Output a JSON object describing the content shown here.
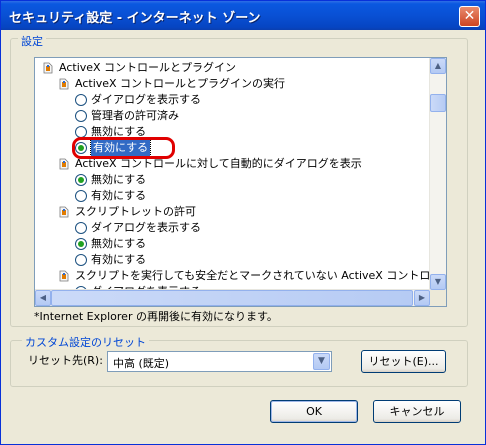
{
  "window": {
    "title": "セキュリティ設定 - インターネット ゾーン",
    "close_glyph": "✕"
  },
  "settings": {
    "group_label": "設定",
    "rows": [
      {
        "type": "category",
        "label": "ActiveX コントロールとプラグイン"
      },
      {
        "type": "category",
        "label": "ActiveX コントロールとプラグインの実行"
      },
      {
        "type": "radio",
        "label": "ダイアログを表示する",
        "checked": false
      },
      {
        "type": "radio",
        "label": "管理者の許可済み",
        "checked": false
      },
      {
        "type": "radio",
        "label": "無効にする",
        "checked": false
      },
      {
        "type": "radio",
        "label": "有効にする",
        "checked": true,
        "selected": true
      },
      {
        "type": "category",
        "label": "ActiveX コントロールに対して自動的にダイアログを表示"
      },
      {
        "type": "radio",
        "label": "無効にする",
        "checked": true
      },
      {
        "type": "radio",
        "label": "有効にする",
        "checked": false
      },
      {
        "type": "category",
        "label": "スクリプトレットの許可"
      },
      {
        "type": "radio",
        "label": "ダイアログを表示する",
        "checked": false
      },
      {
        "type": "radio",
        "label": "無効にする",
        "checked": true
      },
      {
        "type": "radio",
        "label": "有効にする",
        "checked": false
      },
      {
        "type": "category",
        "label": "スクリプトを実行しても安全だとマークされていない ActiveX コントロールの初"
      },
      {
        "type": "radio",
        "label": "ダイアログを表示する",
        "checked": false
      }
    ],
    "note": "*Internet Explorer の再開後に有効になります。"
  },
  "reset": {
    "group_label": "カスタム設定のリセット",
    "label": "リセット先(R):",
    "selected_value": "中高 (既定)",
    "reset_button": "リセット(E)..."
  },
  "buttons": {
    "ok": "OK",
    "cancel": "キャンセル"
  },
  "scroll_glyphs": {
    "up": "▲",
    "down": "▼",
    "left": "◀",
    "right": "▶"
  },
  "colors": {
    "titlebar": "#0a58e0",
    "selection": "#316ac5",
    "highlight_oval": "#e00000",
    "group_label": "#0046d5"
  }
}
